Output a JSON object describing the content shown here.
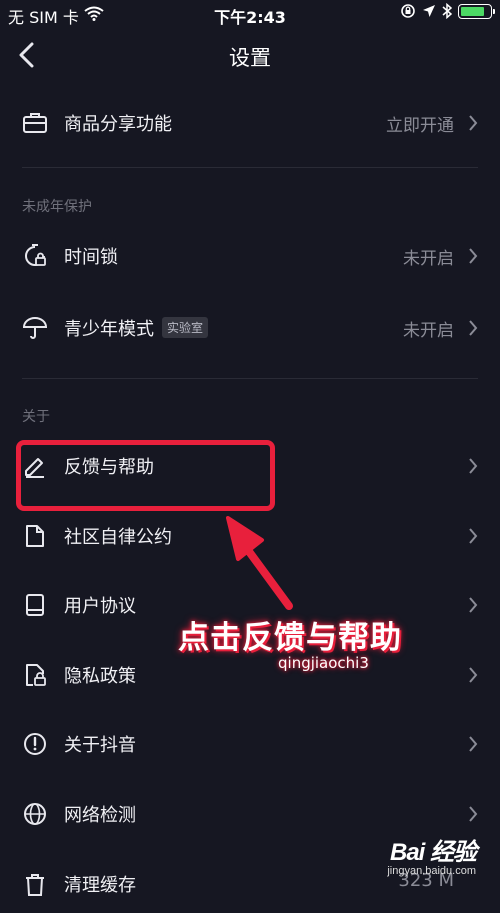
{
  "status_bar": {
    "carrier": "无 SIM 卡",
    "time": "下午2:43",
    "battery_level": 0.9
  },
  "navbar": {
    "title": "设置"
  },
  "rows": [
    {
      "label": "商品分享功能",
      "status": "立即开通",
      "icon": "briefcase-icon"
    },
    {
      "label": "时间锁",
      "status": "未开启",
      "icon": "timer-lock-icon"
    },
    {
      "label": "青少年模式",
      "badge": "实验室",
      "status": "未开启",
      "icon": "umbrella-icon"
    },
    {
      "label": "反馈与帮助",
      "icon": "pen-icon"
    },
    {
      "label": "社区自律公约",
      "icon": "document-icon"
    },
    {
      "label": "用户协议",
      "icon": "book-icon"
    },
    {
      "label": "隐私政策",
      "icon": "privacy-lock-icon"
    },
    {
      "label": "关于抖音",
      "icon": "info-icon"
    },
    {
      "label": "网络检测",
      "icon": "globe-icon"
    },
    {
      "label": "清理缓存",
      "status": "323 M",
      "icon": "trash-icon"
    }
  ],
  "sections": {
    "minor_protection": "未成年保护",
    "about": "关于"
  },
  "annotation": {
    "text": "点击反馈与帮助",
    "author": "qingjiaochi3",
    "color": "#e8203c"
  },
  "watermark": {
    "logo": "Bai 经验",
    "site": "jingyan.baidu.com"
  }
}
